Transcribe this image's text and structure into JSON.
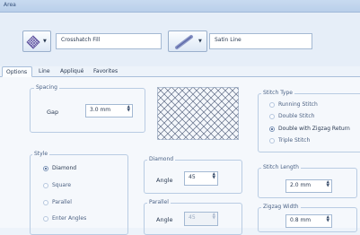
{
  "window": {
    "title": "Area"
  },
  "toolbar": {
    "fill_value": "Crosshatch Fill",
    "line_value": "Satin Line"
  },
  "tabs": [
    {
      "label": "Options"
    },
    {
      "label": "Line"
    },
    {
      "label": "Appliqué"
    },
    {
      "label": "Favorites"
    }
  ],
  "spacing": {
    "title": "Spacing",
    "gap_label": "Gap",
    "gap_value": "3.0 mm"
  },
  "style": {
    "title": "Style",
    "options": [
      "Diamond",
      "Square",
      "Parallel",
      "Enter Angles"
    ],
    "selected": "Diamond"
  },
  "diamond": {
    "title": "Diamond",
    "angle_label": "Angle",
    "angle_value": "45"
  },
  "parallel": {
    "title": "Parallel",
    "angle_label": "Angle",
    "angle_value": "45"
  },
  "stitch_type": {
    "title": "Stitch Type",
    "options": [
      "Running Stitch",
      "Double Stitch",
      "Double with Zigzag Return",
      "Triple Stitch"
    ],
    "selected": "Double with Zigzag Return"
  },
  "stitch_length": {
    "title": "Stitch Length",
    "value": "2.0 mm"
  },
  "zigzag_width": {
    "title": "Zigzag Width",
    "value": "0.8 mm"
  }
}
